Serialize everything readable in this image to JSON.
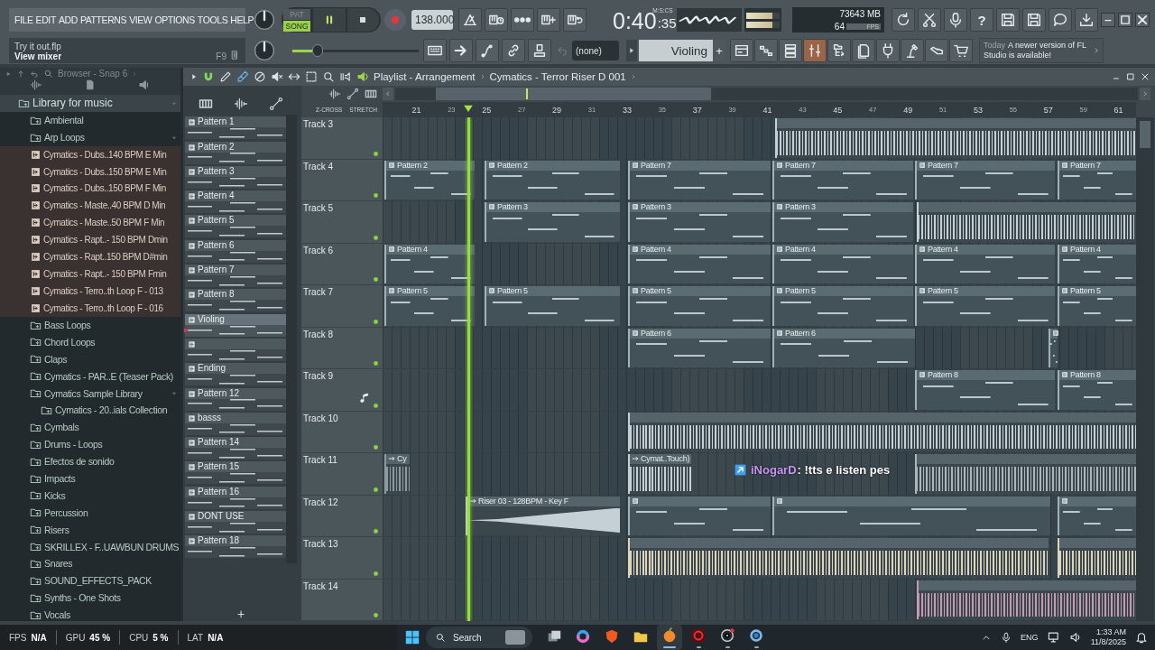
{
  "menu": [
    "FILE",
    "EDIT",
    "ADD",
    "PATTERNS",
    "VIEW",
    "OPTIONS",
    "TOOLS",
    "HELP"
  ],
  "hint": {
    "file": "Try it out.flp",
    "action": "View mixer",
    "shortcut": "F9"
  },
  "transport": {
    "modes": [
      {
        "label": "PAT",
        "selected": false
      },
      {
        "label": "SONG",
        "selected": true
      }
    ],
    "playing": true,
    "tempo": "138.000"
  },
  "main_volume": {
    "level": 0.16
  },
  "record_buttons": [
    {
      "kind": "metronome"
    },
    {
      "kind": "wait"
    },
    {
      "kind": "countdown"
    },
    {
      "kind": "step"
    },
    {
      "kind": "loop"
    }
  ],
  "edit_buttons": [
    {
      "kind": "typing"
    },
    {
      "kind": "arrow"
    },
    {
      "kind": "curve"
    },
    {
      "kind": "link"
    },
    {
      "kind": "stamp"
    }
  ],
  "time": {
    "main": "0:40",
    "sub": ":35",
    "format": "M:S:CS"
  },
  "output_meter": [
    {
      "level": 0.78
    },
    {
      "level": 0.78
    }
  ],
  "monitor": {
    "cpu": "7",
    "memory": "3643 MB",
    "polyphony": "64",
    "unit": "FPS"
  },
  "tool_buttons": [
    {
      "kind": "refresh"
    },
    {
      "kind": "scissors"
    },
    {
      "kind": "mic"
    },
    {
      "kind": "help",
      "label": "?"
    },
    {
      "kind": "save"
    },
    {
      "kind": "save"
    },
    {
      "kind": "chat"
    },
    {
      "kind": "download"
    }
  ],
  "pattern_picker": {
    "value": "(none)"
  },
  "pattern_selector": {
    "value": "Violing",
    "add": "+"
  },
  "view_buttons": [
    {
      "kind": "playlist",
      "active": false
    },
    {
      "kind": "piano",
      "active": false
    },
    {
      "kind": "rack",
      "active": false
    },
    {
      "kind": "mixer",
      "active": true
    },
    {
      "kind": "tree",
      "active": false
    },
    {
      "kind": "files",
      "active": false
    },
    {
      "kind": "plug",
      "active": false
    },
    {
      "kind": "lamp",
      "active": false
    },
    {
      "kind": "hand",
      "active": false
    },
    {
      "kind": "cart",
      "active": false
    }
  ],
  "news": {
    "date": "Today",
    "message": "A newer version of FL Studio is available!"
  },
  "browser": {
    "title": "Browser - Snap 6",
    "tree": [
      {
        "label": "Library for music",
        "kind": "folder",
        "expanded": true,
        "children": [
          {
            "label": "Ambiental",
            "kind": "folder",
            "expanded": false
          },
          {
            "label": "Arp Loops",
            "kind": "folder",
            "expanded": true,
            "children": [
              {
                "label": "Cymatics - Dubs..140 BPM E Min",
                "kind": "loop"
              },
              {
                "label": "Cymatics - Dubs..150 BPM E Min",
                "kind": "loop"
              },
              {
                "label": "Cymatics - Dubs..150 BPM F Min",
                "kind": "loop"
              },
              {
                "label": "Cymatics - Maste..40 BPM D Min",
                "kind": "loop"
              },
              {
                "label": "Cymatics - Maste..50 BPM F Min",
                "kind": "loop"
              },
              {
                "label": "Cymatics - Rapt..- 150 BPM Dmin",
                "kind": "loop"
              },
              {
                "label": "Cymatics - Rapt..150 BPM D#min",
                "kind": "loop"
              },
              {
                "label": "Cymatics - Rapt..- 150 BPM Fmin",
                "kind": "loop"
              },
              {
                "label": "Cymatics - Terro..th Loop F  - 013",
                "kind": "loop"
              },
              {
                "label": "Cymatics - Terro..th Loop F  - 016",
                "kind": "loop"
              }
            ]
          },
          {
            "label": "Bass Loops",
            "kind": "folder",
            "expanded": false
          },
          {
            "label": "Chord Loops",
            "kind": "folder",
            "expanded": false
          },
          {
            "label": "Claps",
            "kind": "folder",
            "expanded": false
          },
          {
            "label": "Cymatics - PAR..E (Teaser Pack)",
            "kind": "folder",
            "expanded": false
          },
          {
            "label": "Cymatics Sample Library",
            "kind": "folder",
            "expanded": true,
            "children": [
              {
                "label": "Cymatics - 20..ials Collection",
                "kind": "folder",
                "expanded": false
              }
            ]
          },
          {
            "label": "Cymbals",
            "kind": "folder",
            "expanded": false
          },
          {
            "label": "Drums - Loops",
            "kind": "folder",
            "expanded": false
          },
          {
            "label": "Efectos de sonido",
            "kind": "folder",
            "expanded": false
          },
          {
            "label": "Impacts",
            "kind": "folder",
            "expanded": false
          },
          {
            "label": "Kicks",
            "kind": "folder",
            "expanded": false
          },
          {
            "label": "Percussion",
            "kind": "folder",
            "expanded": false
          },
          {
            "label": "Risers",
            "kind": "folder",
            "expanded": false
          },
          {
            "label": "SKRILLEX - F..UAWBUN DRUMS",
            "kind": "folder",
            "expanded": false
          },
          {
            "label": "Snares",
            "kind": "folder",
            "expanded": false
          },
          {
            "label": "SOUND_EFFECTS_PACK",
            "kind": "folder",
            "expanded": false
          },
          {
            "label": "Synths - One Shots",
            "kind": "folder",
            "expanded": false
          },
          {
            "label": "Vocals",
            "kind": "folder",
            "expanded": false
          }
        ]
      }
    ]
  },
  "patterns": {
    "items": [
      {
        "label": "Pattern 1",
        "selected": false
      },
      {
        "label": "Pattern 2",
        "selected": false
      },
      {
        "label": "Pattern 3",
        "selected": false
      },
      {
        "label": "Pattern 4",
        "selected": false
      },
      {
        "label": "Pattern 5",
        "selected": false
      },
      {
        "label": "Pattern 6",
        "selected": false
      },
      {
        "label": "Pattern 7",
        "selected": false
      },
      {
        "label": "Pattern 8",
        "selected": false
      },
      {
        "label": "Violing",
        "selected": true
      },
      {
        "selected": false
      },
      {
        "label": "Ending",
        "selected": false
      },
      {
        "label": "Pattern 12",
        "selected": false
      },
      {
        "label": "basss",
        "selected": false
      },
      {
        "label": "Pattern 14",
        "selected": false
      },
      {
        "label": "Pattern 15",
        "selected": false
      },
      {
        "label": "Pattern 16",
        "selected": false
      },
      {
        "label": "DONT  USE",
        "selected": false
      },
      {
        "label": "Pattern 18",
        "selected": false
      }
    ],
    "add": "+"
  },
  "playlist": {
    "title": "Playlist - Arrangement",
    "path": "Cymatics - Terror Riser D 001",
    "toggles": [
      "Z-CROSS",
      "STRETCH"
    ],
    "ruler": [
      "21",
      "23",
      "25",
      "27",
      "29",
      "31",
      "33",
      "35",
      "37",
      "39",
      "41",
      "43",
      "45",
      "47",
      "49",
      "51",
      "53",
      "55",
      "57",
      "59",
      "61"
    ],
    "tracks": [
      {
        "name": "Track 3",
        "kind": "plain",
        "clips": [
          {
            "kind": "audio",
            "color": "#c5d0d6"
          }
        ]
      },
      {
        "name": "Track 4",
        "kind": "plain",
        "clips": [
          {
            "kind": "pattern",
            "label": "Pattern 2"
          },
          {
            "kind": "pattern",
            "label": "Pattern 2"
          },
          {
            "kind": "pattern",
            "label": "Pattern 7"
          },
          {
            "kind": "pattern",
            "label": "Pattern 7"
          },
          {
            "kind": "pattern",
            "label": "Pattern 7"
          },
          {
            "kind": "pattern",
            "label": "Pattern 7"
          }
        ]
      },
      {
        "name": "Track 5",
        "kind": "plain",
        "clips": [
          {
            "kind": "pattern",
            "label": "Pattern 3"
          },
          {
            "kind": "pattern",
            "label": "Pattern 3"
          },
          {
            "kind": "pattern",
            "label": "Pattern 3"
          },
          {
            "kind": "audio",
            "color": "#c5d0d6"
          }
        ]
      },
      {
        "name": "Track 6",
        "kind": "plain",
        "clips": [
          {
            "kind": "pattern",
            "label": "Pattern 4"
          },
          {
            "kind": "pattern",
            "label": "Pattern 4"
          },
          {
            "kind": "pattern",
            "label": "Pattern 4"
          },
          {
            "kind": "pattern",
            "label": "Pattern 4"
          },
          {
            "kind": "pattern",
            "label": "Pattern 4"
          }
        ]
      },
      {
        "name": "Track 7",
        "kind": "plain",
        "clips": [
          {
            "kind": "pattern",
            "label": "Pattern 5"
          },
          {
            "kind": "pattern",
            "label": "Pattern 5"
          },
          {
            "kind": "pattern",
            "label": "Pattern 5"
          },
          {
            "kind": "pattern",
            "label": "Pattern 5"
          },
          {
            "kind": "pattern",
            "label": "Pattern 5"
          },
          {
            "kind": "pattern",
            "label": "Pattern 5"
          }
        ]
      },
      {
        "name": "Track 8",
        "kind": "plain",
        "clips": [
          {
            "kind": "pattern",
            "label": "Pattern 6"
          },
          {
            "kind": "pattern",
            "label": "Pattern 6"
          },
          {
            "kind": "pattern"
          }
        ]
      },
      {
        "name": "Track 9",
        "kind": "instrument",
        "clips": [
          {
            "kind": "pattern",
            "label": "Pattern 8"
          },
          {
            "kind": "pattern",
            "label": "Pattern 8"
          }
        ]
      },
      {
        "name": "Track 10",
        "kind": "plain",
        "clips": [
          {
            "kind": "audio",
            "color": "#c5d0d6"
          }
        ]
      },
      {
        "name": "Track 11",
        "kind": "plain",
        "clips": [
          {
            "kind": "audio",
            "label": "Cy",
            "color": "#8d9ba1"
          },
          {
            "kind": "audio",
            "label": "Cymat..Touch)",
            "color": "#c5d0d6"
          },
          {
            "kind": "audio",
            "color": "#aab6bc"
          }
        ]
      },
      {
        "name": "Track 12",
        "kind": "plain",
        "clips": [
          {
            "kind": "swell",
            "label": "Riser 03 - 128BPM - Key F",
            "color": "#c5d0d6"
          },
          {
            "kind": "pattern"
          },
          {
            "kind": "pattern"
          },
          {
            "kind": "pattern"
          }
        ]
      },
      {
        "name": "Track 13",
        "kind": "plain",
        "clips": [
          {
            "kind": "audio",
            "color": "#ddd6bd"
          },
          {
            "kind": "audio",
            "color": "#ddd6bd"
          }
        ]
      },
      {
        "name": "Track 14",
        "kind": "plain",
        "clips": [
          {
            "kind": "audio",
            "color": "#c39ab3"
          }
        ]
      }
    ],
    "chat": {
      "user": "iNogarD",
      "message": ": !tts e listen pes"
    }
  },
  "status": [
    {
      "label": "FPS",
      "value": "N/A"
    },
    {
      "label": "GPU",
      "value": "45 %"
    },
    {
      "label": "CPU",
      "value": "5 %"
    },
    {
      "label": "LAT",
      "value": "N/A"
    }
  ],
  "taskbar": {
    "search": "Search",
    "apps": [
      {
        "kind": "taskview",
        "open": false,
        "selected": false
      },
      {
        "kind": "swirl",
        "open": false,
        "selected": false
      },
      {
        "kind": "shield",
        "open": false,
        "selected": false
      },
      {
        "kind": "folder",
        "open": false,
        "selected": false
      },
      {
        "kind": "fruit",
        "open": true,
        "selected": true
      },
      {
        "kind": "ring",
        "open": true,
        "selected": false
      },
      {
        "kind": "nodes",
        "open": true,
        "selected": false
      },
      {
        "kind": "gear",
        "open": true,
        "selected": false
      }
    ],
    "language": "ENG",
    "clock": "1:33 AM",
    "date": "11/8/2025"
  }
}
